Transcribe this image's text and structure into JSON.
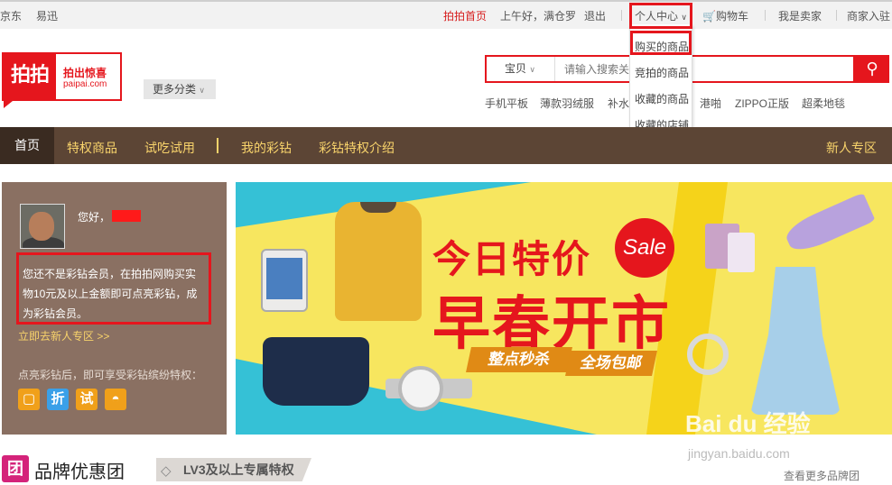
{
  "topbar": {
    "left_links": [
      "京东",
      "易迅"
    ],
    "home": "拍拍首页",
    "greeting": "上午好，满仓罗",
    "logout": "退出",
    "personal_center": "个人中心",
    "cart": "购物车",
    "seller": "我是卖家",
    "merchant": "商家入驻"
  },
  "dropdown": {
    "items": [
      "购买的商品",
      "竞拍的商品",
      "收藏的商品",
      "收藏的店铺"
    ]
  },
  "logo": {
    "main": "拍拍",
    "slogan": "拍出惊喜",
    "domain": "paipai.com"
  },
  "more_categories": "更多分类",
  "search": {
    "category": "宝贝",
    "placeholder": "请输入搜索关键字",
    "hotwords": [
      "手机平板",
      "薄款羽绒服",
      "补水",
      "港啪",
      "ZIPPO正版",
      "超柔地毯"
    ]
  },
  "nav": {
    "home": "首页",
    "items": [
      "特权商品",
      "试吃试用",
      "我的彩钻",
      "彩钻特权介绍"
    ],
    "right": "新人专区"
  },
  "user_panel": {
    "hello": "您好，",
    "notice": "您还不是彩钻会员，在拍拍网购买实物10元及以上金额即可点亮彩钻，成为彩钻会员。",
    "go_newbie": "立即去新人专区 >>",
    "privilege_text": "点亮彩钻后，即可享受彩钻缤纷特权：",
    "badges": [
      {
        "glyph": "",
        "color": "#f0a01a"
      },
      {
        "glyph": "折",
        "color": "#3aa0e8"
      },
      {
        "glyph": "试",
        "color": "#f0a01a"
      },
      {
        "glyph": "",
        "color": "#f0a01a"
      }
    ]
  },
  "banner": {
    "title": "今日特价",
    "sale": "Sale",
    "headline": "早春开市",
    "tag1": "整点秒杀",
    "tag2": "全场包邮"
  },
  "watermark": {
    "logo": "Bai du 经验",
    "url": "jingyan.baidu.com"
  },
  "brand_section": {
    "icon": "团",
    "title": "品牌优惠团",
    "level_tag": "LV3及以上专属特权",
    "more": "查看更多品牌团"
  },
  "colors": {
    "brand_red": "#e5161d",
    "nav_bg": "#5c4535",
    "nav_text": "#f8d36b",
    "panel_bg": "#8a7062",
    "banner_cyan": "#35c1d6"
  }
}
